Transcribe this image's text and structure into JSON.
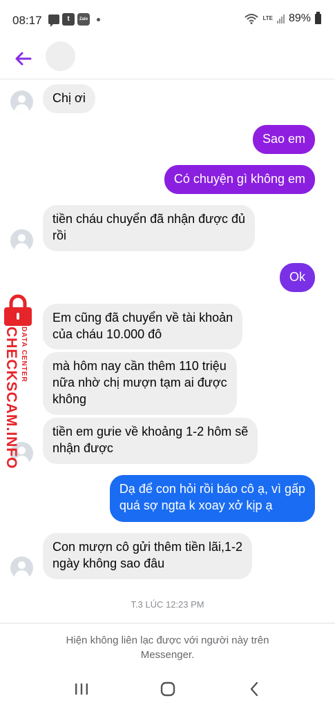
{
  "status_bar": {
    "time": "08:17",
    "zalo_icon_label": "Zalo",
    "box_icon_label": "t",
    "network": "LTE",
    "battery_percent": "89%"
  },
  "header": {
    "back_icon": "arrow-left-icon",
    "accent_color": "#8a2be2"
  },
  "messages": [
    {
      "direction": "incoming",
      "text": "Chị ơi"
    },
    {
      "direction": "outgoing",
      "text": "Sao em",
      "color": "#8f1ee0"
    },
    {
      "direction": "outgoing",
      "text": "Có chuyện gì không em",
      "color": "#8a1fe0"
    },
    {
      "direction": "incoming",
      "text": "tiền cháu chuyển đã nhận được đủ\nrồi"
    },
    {
      "direction": "outgoing",
      "text": "Ok",
      "color": "#7a30e6"
    },
    {
      "direction": "incoming",
      "text": "Em cũng đã chuyển về tài khoản\ncủa cháu 10.000 đô"
    },
    {
      "direction": "incoming",
      "text": "mà hôm nay cần thêm 110 triệu\nnữa nhờ chị mượn tạm ai được\nkhông"
    },
    {
      "direction": "incoming",
      "text": "tiền em gưie về khoảng 1-2 hôm sẽ\nnhận được"
    },
    {
      "direction": "outgoing",
      "text": "Dạ để con hỏi rồi báo cô ạ, vì gấp\nquá sợ ngta k xoay xở kịp ạ",
      "color": "#1a6cf2"
    },
    {
      "direction": "incoming",
      "text": "Con mượn cô gửi thêm tiền lãi,1-2\nngày không sao đâu"
    }
  ],
  "timestamp": "T.3 LÚC 12:23 PM",
  "watermark": {
    "main": "CHECKSCAM.INFO",
    "sub": "DATA CENTER",
    "color": "#e5252a"
  },
  "footer": {
    "notice": "Hiện không liên lạc được với người này trên\nMessenger."
  },
  "navbar": {
    "recents_icon": "recent-apps-icon",
    "home_icon": "home-icon",
    "back_icon": "back-chevron-icon"
  }
}
